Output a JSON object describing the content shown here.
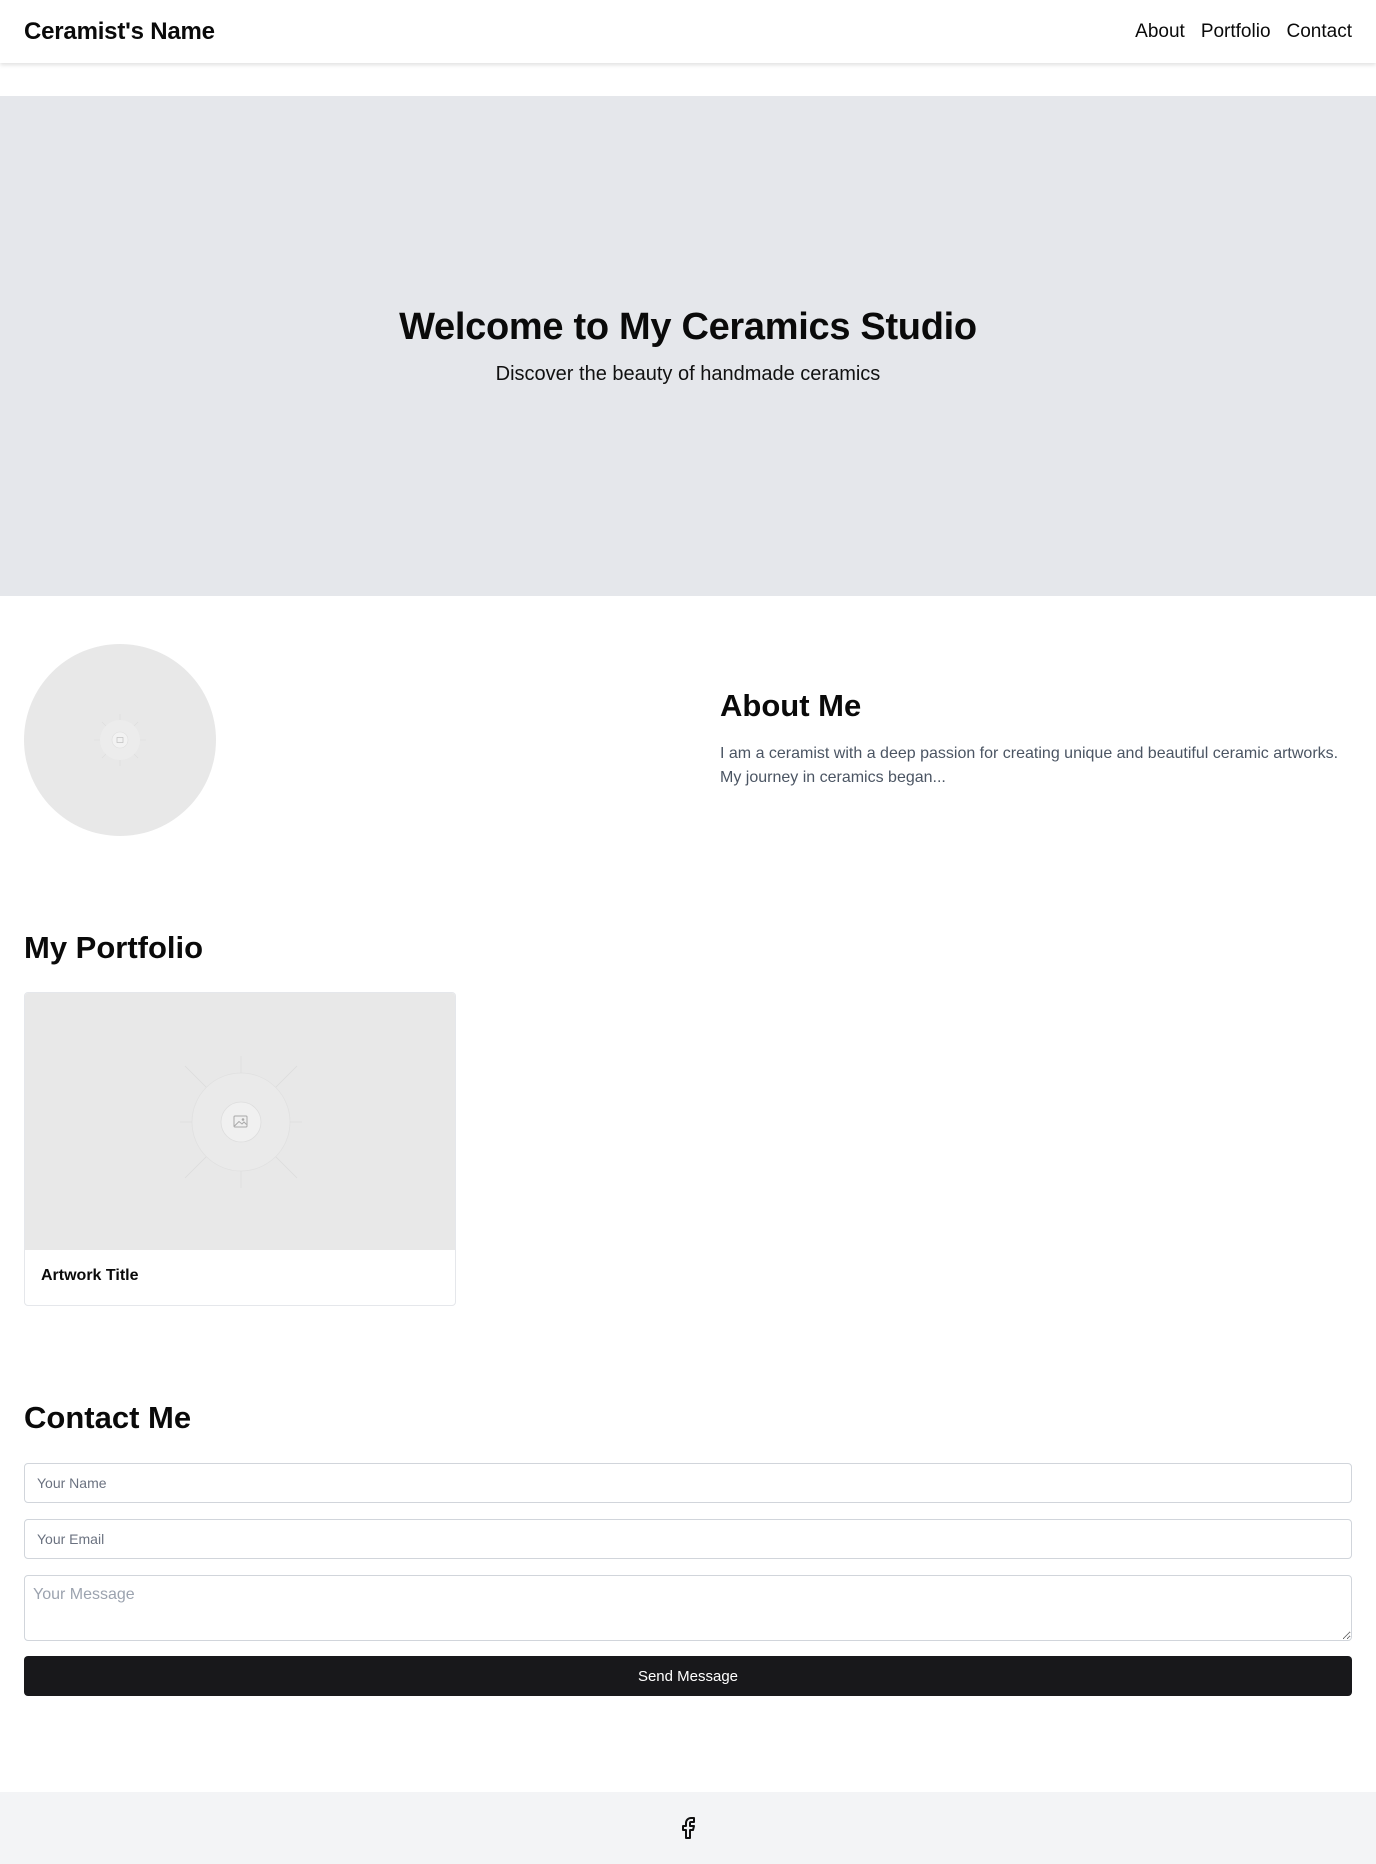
{
  "header": {
    "brand": "Ceramist's Name",
    "nav": [
      "About",
      "Portfolio",
      "Contact"
    ]
  },
  "hero": {
    "title": "Welcome to My Ceramics Studio",
    "subtitle": "Discover the beauty of handmade ceramics"
  },
  "about": {
    "avatar_icon": "image-placeholder-icon",
    "title": "About Me",
    "text": "I am a ceramist with a deep passion for creating unique and beautiful ceramic artworks. My journey in ceramics began..."
  },
  "portfolio": {
    "title": "My Portfolio",
    "items": [
      {
        "title": "Artwork Title",
        "icon": "image-placeholder-icon"
      }
    ]
  },
  "contact": {
    "title": "Contact Me",
    "name_placeholder": "Your Name",
    "email_placeholder": "Your Email",
    "message_placeholder": "Your Message",
    "submit_label": "Send Message"
  },
  "footer": {
    "social_icon": "facebook-icon"
  },
  "colors": {
    "hero_bg": "#e5e7eb",
    "button_bg": "#18181b",
    "footer_bg": "#f3f4f6",
    "placeholder_bg": "#e8e8e8",
    "body_text_muted": "#4b5563"
  }
}
